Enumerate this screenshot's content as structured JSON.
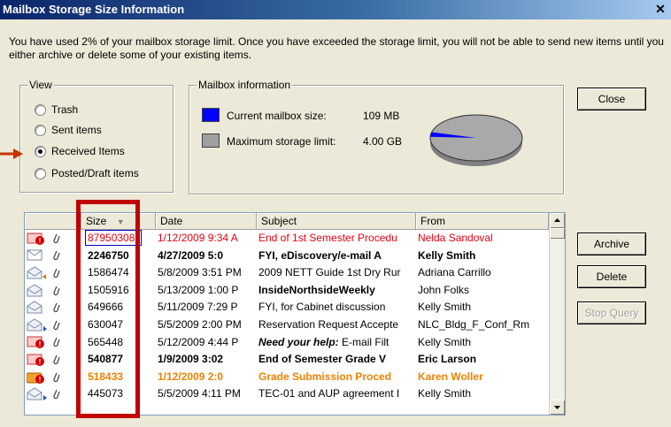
{
  "window": {
    "title": "Mailbox Storage Size Information",
    "close_glyph": "✕"
  },
  "intro": "You have used 2% of your mailbox storage limit.  Once you have exceeded the storage limit, you will not be able to send new items until you either archive or delete some of your existing items.",
  "view": {
    "legend": "View",
    "options": [
      {
        "label": "Trash",
        "selected": false
      },
      {
        "label": "Sent items",
        "selected": false
      },
      {
        "label": "Received Items",
        "selected": true
      },
      {
        "label": "Posted/Draft items",
        "selected": false
      }
    ]
  },
  "mailbox_info": {
    "legend": "Mailbox information",
    "current_label": "Current mailbox size:",
    "current_value": "109 MB",
    "max_label": "Maximum storage limit:",
    "max_value": "4.00 GB",
    "used_fraction": 0.02,
    "current_color": "#0000ff",
    "max_color": "#a0a0a0"
  },
  "buttons": {
    "close": "Close",
    "archive": "Archive",
    "delete": "Delete",
    "stop_query": "Stop Query"
  },
  "table": {
    "columns": {
      "size": "Size",
      "date": "Date",
      "subject": "Subject",
      "from": "From"
    },
    "sort_glyph": "▼",
    "rows": [
      {
        "icon": "priority-envelope-icon",
        "size": "87950308",
        "date": "1/12/2009 9:34 A",
        "subject": "End of 1st Semester Procedu",
        "from": "Nelda Sandoval",
        "style": "red"
      },
      {
        "icon": "envelope-icon",
        "size": "2246750",
        "date": "4/27/2009 5:0",
        "subject": "FYI, eDiscovery/e-mail A",
        "from": "Kelly Smith",
        "style": "bold"
      },
      {
        "icon": "reply-envelope-icon",
        "size": "1586474",
        "date": "5/8/2009 3:51 PM",
        "subject": "2009 NETT Guide 1st Dry Rur",
        "from": "Adriana Carrillo",
        "style": ""
      },
      {
        "icon": "open-envelope-icon",
        "size": "1505916",
        "date": "5/13/2009 1:00 P",
        "subject": "InsideNorthsideWeekly",
        "from": "John Folks",
        "style": "subject-bold"
      },
      {
        "icon": "open-envelope-icon",
        "size": "649666",
        "date": "5/11/2009 7:29 P",
        "subject": "FYI, for Cabinet discussion",
        "from": "Kelly Smith",
        "style": ""
      },
      {
        "icon": "forward-envelope-icon",
        "size": "630047",
        "date": "5/5/2009 2:00 PM",
        "subject": "Reservation Request Accepte",
        "from": "NLC_Bldg_F_Conf_Rm",
        "style": ""
      },
      {
        "icon": "priority-envelope-icon",
        "size": "565448",
        "date": "5/12/2009 4:44 P",
        "subject": "Need your help:",
        "subject_rest": " E-mail Filt",
        "from": "Kelly Smith",
        "style": "italic-subject"
      },
      {
        "icon": "priority-envelope-icon",
        "size": "540877",
        "date": "1/9/2009 3:02",
        "subject": "End of Semester Grade V",
        "from": "Eric Larson",
        "style": "bold"
      },
      {
        "icon": "folder-priority-icon",
        "size": "518433",
        "date": "1/12/2009 2:0",
        "subject": "Grade Submission Proced",
        "from": "Karen Woller",
        "style": "orange bold"
      },
      {
        "icon": "forward-envelope-icon",
        "size": "445073",
        "date": "5/5/2009 4:11 PM",
        "subject": "TEC-01 and AUP agreement I",
        "from": "Kelly Smith",
        "style": ""
      }
    ]
  }
}
